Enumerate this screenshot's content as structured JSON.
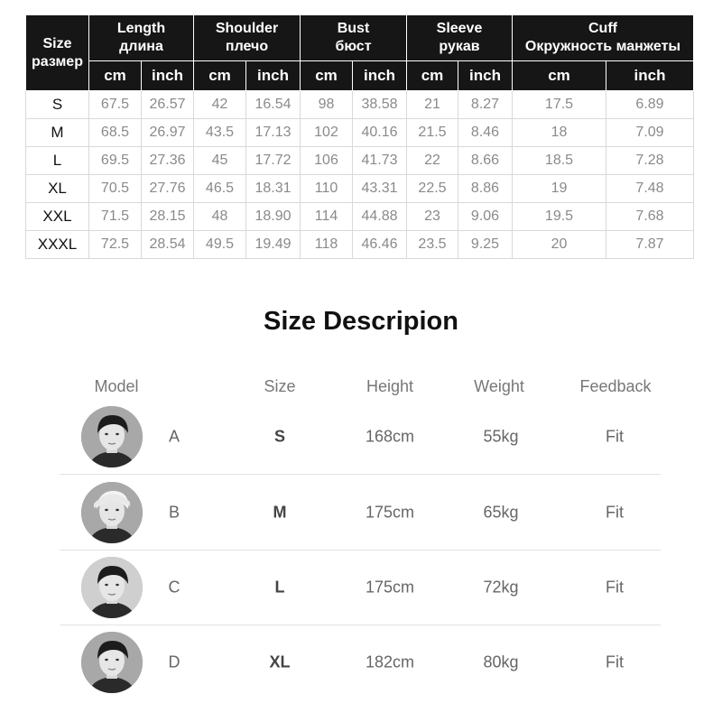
{
  "size_chart": {
    "header": {
      "size": "Size",
      "size_ru": "размер",
      "groups": [
        {
          "en": "Length",
          "ru": "длина"
        },
        {
          "en": "Shoulder",
          "ru": "плечо"
        },
        {
          "en": "Bust",
          "ru": "бюст"
        },
        {
          "en": "Sleeve",
          "ru": "рукав"
        },
        {
          "en": "Cuff",
          "ru": "Окружность манжеты"
        }
      ],
      "unit_cm": "cm",
      "unit_inch": "inch"
    },
    "rows": [
      {
        "size": "S",
        "length_cm": "67.5",
        "length_in": "26.57",
        "shoulder_cm": "42",
        "shoulder_in": "16.54",
        "bust_cm": "98",
        "bust_in": "38.58",
        "sleeve_cm": "21",
        "sleeve_in": "8.27",
        "cuff_cm": "17.5",
        "cuff_in": "6.89"
      },
      {
        "size": "M",
        "length_cm": "68.5",
        "length_in": "26.97",
        "shoulder_cm": "43.5",
        "shoulder_in": "17.13",
        "bust_cm": "102",
        "bust_in": "40.16",
        "sleeve_cm": "21.5",
        "sleeve_in": "8.46",
        "cuff_cm": "18",
        "cuff_in": "7.09"
      },
      {
        "size": "L",
        "length_cm": "69.5",
        "length_in": "27.36",
        "shoulder_cm": "45",
        "shoulder_in": "17.72",
        "bust_cm": "106",
        "bust_in": "41.73",
        "sleeve_cm": "22",
        "sleeve_in": "8.66",
        "cuff_cm": "18.5",
        "cuff_in": "7.28"
      },
      {
        "size": "XL",
        "length_cm": "70.5",
        "length_in": "27.76",
        "shoulder_cm": "46.5",
        "shoulder_in": "18.31",
        "bust_cm": "110",
        "bust_in": "43.31",
        "sleeve_cm": "22.5",
        "sleeve_in": "8.86",
        "cuff_cm": "19",
        "cuff_in": "7.48"
      },
      {
        "size": "XXL",
        "length_cm": "71.5",
        "length_in": "28.15",
        "shoulder_cm": "48",
        "shoulder_in": "18.90",
        "bust_cm": "114",
        "bust_in": "44.88",
        "sleeve_cm": "23",
        "sleeve_in": "9.06",
        "cuff_cm": "19.5",
        "cuff_in": "7.68"
      },
      {
        "size": "XXXL",
        "length_cm": "72.5",
        "length_in": "28.54",
        "shoulder_cm": "49.5",
        "shoulder_in": "19.49",
        "bust_cm": "118",
        "bust_in": "46.46",
        "sleeve_cm": "23.5",
        "sleeve_in": "9.25",
        "cuff_cm": "20",
        "cuff_in": "7.87"
      }
    ]
  },
  "description": {
    "title": "Size Descripion",
    "columns": {
      "model": "Model",
      "size": "Size",
      "height": "Height",
      "weight": "Weight",
      "feedback": "Feedback"
    },
    "models": [
      {
        "label": "A",
        "size": "S",
        "height": "168cm",
        "weight": "55kg",
        "feedback": "Fit"
      },
      {
        "label": "B",
        "size": "M",
        "height": "175cm",
        "weight": "65kg",
        "feedback": "Fit"
      },
      {
        "label": "C",
        "size": "L",
        "height": "175cm",
        "weight": "72kg",
        "feedback": "Fit"
      },
      {
        "label": "D",
        "size": "XL",
        "height": "182cm",
        "weight": "80kg",
        "feedback": "Fit"
      }
    ]
  },
  "colors": {
    "header_bg": "#161616",
    "header_text": "#ffffff",
    "cell_text": "#8a8a8a",
    "grid_line": "#d9d9d9"
  }
}
